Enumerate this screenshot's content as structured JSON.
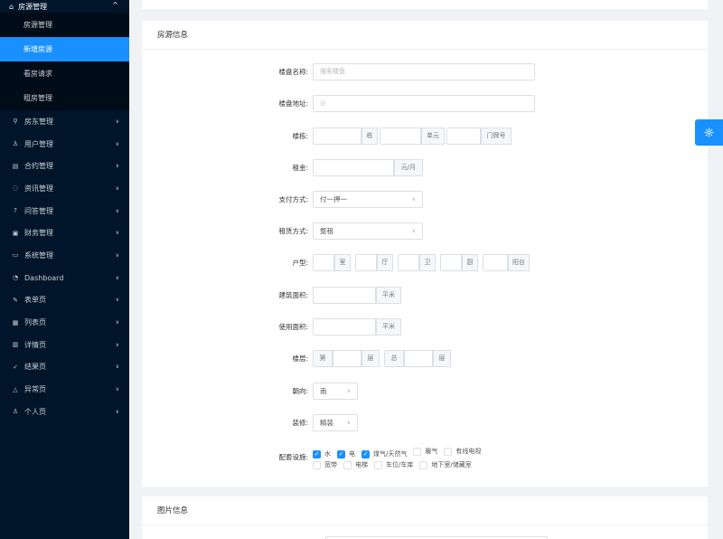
{
  "sidebar": {
    "top_item": "房源管理",
    "sub_items": [
      "房源管理",
      "新增房源",
      "看房请求",
      "租房管理"
    ],
    "items": [
      {
        "label": "房东管理",
        "icon": "search-icon"
      },
      {
        "label": "用户管理",
        "icon": "user-icon"
      },
      {
        "label": "合约管理",
        "icon": "file-icon"
      },
      {
        "label": "资讯管理",
        "icon": "chat-icon"
      },
      {
        "label": "问答管理",
        "icon": "question-icon"
      },
      {
        "label": "财务管理",
        "icon": "finance-icon"
      },
      {
        "label": "系统管理",
        "icon": "monitor-icon"
      },
      {
        "label": "Dashboard",
        "icon": "dashboard-icon"
      },
      {
        "label": "表单页",
        "icon": "form-icon"
      },
      {
        "label": "列表页",
        "icon": "table-icon"
      },
      {
        "label": "详情页",
        "icon": "profile-icon"
      },
      {
        "label": "结果页",
        "icon": "check-circle-icon"
      },
      {
        "label": "异常页",
        "icon": "warning-icon"
      },
      {
        "label": "个人页",
        "icon": "user-icon"
      }
    ]
  },
  "form": {
    "section_title": "房源信息",
    "estate_name": {
      "label": "楼盘名称:",
      "placeholder": "搜索楼盘"
    },
    "estate_address": {
      "label": "楼盘地址:"
    },
    "building": {
      "label": "楼栋:",
      "unit1": "栋",
      "unit2": "单元",
      "unit3": "门牌号"
    },
    "rent": {
      "label": "租金:",
      "unit": "元/月"
    },
    "payment": {
      "label": "支付方式:",
      "value": "付一押一"
    },
    "rental_type": {
      "label": "租赁方式:",
      "value": "整租"
    },
    "layout": {
      "label": "户型:",
      "units": [
        "室",
        "厅",
        "卫",
        "厨",
        "阳台"
      ]
    },
    "build_area": {
      "label": "建筑面积:",
      "unit": "平米"
    },
    "use_area": {
      "label": "使用面积:",
      "unit": "平米"
    },
    "floor": {
      "label": "楼层:",
      "prefix1": "第",
      "suffix1": "层",
      "prefix2": "总",
      "suffix2": "层"
    },
    "orientation": {
      "label": "朝向:",
      "value": "南"
    },
    "decoration": {
      "label": "装修:",
      "value": "精装"
    },
    "facilities": {
      "label": "配套设施:",
      "options": [
        {
          "label": "水",
          "checked": true
        },
        {
          "label": "电",
          "checked": true
        },
        {
          "label": "煤气/天然气",
          "checked": true
        },
        {
          "label": "暖气",
          "checked": false
        },
        {
          "label": "有线电视",
          "checked": false
        },
        {
          "label": "宽带",
          "checked": false
        },
        {
          "label": "电梯",
          "checked": false
        },
        {
          "label": "车位/车库",
          "checked": false
        },
        {
          "label": "地下室/储藏室",
          "checked": false
        }
      ]
    }
  },
  "image_section": {
    "title": "图片信息"
  }
}
